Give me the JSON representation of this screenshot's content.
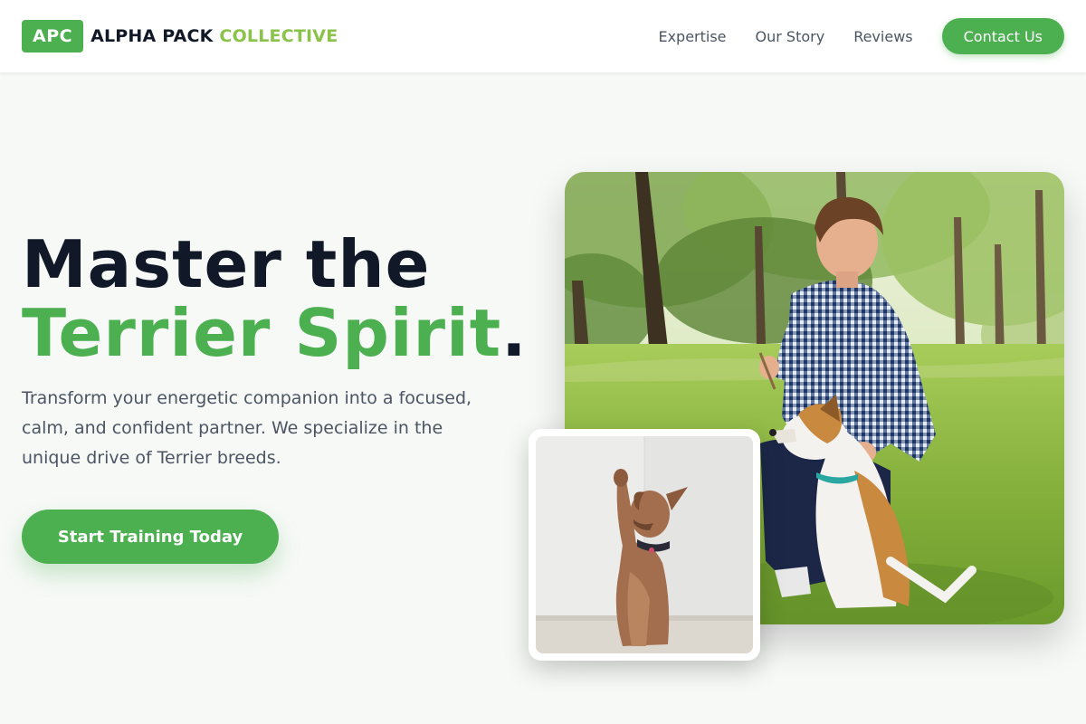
{
  "header": {
    "logo_badge": "APC",
    "logo_name": "ALPHA PACK",
    "logo_accent": "COLLECTIVE",
    "nav": [
      {
        "label": "Expertise"
      },
      {
        "label": "Our Story"
      },
      {
        "label": "Reviews"
      }
    ],
    "contact_label": "Contact Us"
  },
  "hero": {
    "title_line1": "Master the",
    "title_line2_green": "Terrier Spirit",
    "title_period": ".",
    "description": "Transform your energetic companion into a focused, calm, and confident partner. We specialize in the unique drive of Terrier breeds.",
    "cta_label": "Start Training Today"
  },
  "images": {
    "main": "Young man kneeling in a park training a white and tan dog",
    "small": "Brown dog sitting and raising a paw against a white wall"
  },
  "colors": {
    "brand_green": "#4caf50",
    "accent_lime": "#8bc34a",
    "heading_dark": "#111827",
    "body_gray": "#4b5563",
    "background": "#f7f9f7"
  }
}
